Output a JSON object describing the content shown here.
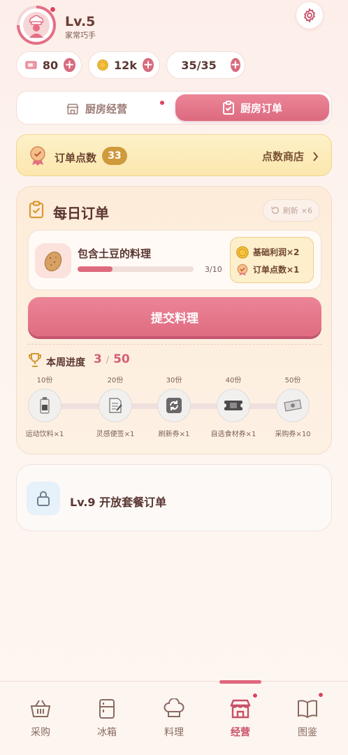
{
  "player": {
    "level": "Lv.5",
    "title": "家常巧手"
  },
  "currencies": [
    {
      "icon": "ticket-icon",
      "value": "80"
    },
    {
      "icon": "coin-icon",
      "value": "12k"
    },
    {
      "icon": "energy-icon",
      "value": "35/35"
    }
  ],
  "tabs": {
    "left": "厨房经营",
    "right": "厨房订单",
    "active": "right"
  },
  "points": {
    "label": "订单点数",
    "count": "33",
    "shop": "点数商店"
  },
  "daily": {
    "title": "每日订单",
    "refresh_label": "刷新",
    "refresh_count": "×6",
    "order": {
      "name": "包含土豆的料理",
      "progress_text": "3/10",
      "progress_fraction": 0.3
    },
    "rewards": [
      {
        "icon": "coin-icon",
        "label": "基础利润×2"
      },
      {
        "icon": "medal-icon",
        "label": "订单点数×1"
      }
    ],
    "submit": "提交料理",
    "week": {
      "label": "本周进度",
      "current": "3",
      "sep": "/",
      "total": "50"
    },
    "milestones": [
      {
        "top": "10份",
        "bottom": "运动饮料×1",
        "icon": "drink-can-icon"
      },
      {
        "top": "20份",
        "bottom": "灵感便签×1",
        "icon": "note-icon"
      },
      {
        "top": "30份",
        "bottom": "刷新券×1",
        "icon": "refresh-ticket-icon"
      },
      {
        "top": "40份",
        "bottom": "自选食材券×1",
        "icon": "ingredient-ticket-icon"
      },
      {
        "top": "50份",
        "bottom": "采购券×10",
        "icon": "purchase-ticket-icon"
      }
    ]
  },
  "locked": {
    "text": "Lv.9 开放套餐订单"
  },
  "nav": [
    {
      "label": "采购",
      "icon": "basket-icon"
    },
    {
      "label": "冰箱",
      "icon": "fridge-icon"
    },
    {
      "label": "料理",
      "icon": "chef-hat-icon"
    },
    {
      "label": "经营",
      "icon": "store-icon"
    },
    {
      "label": "图鉴",
      "icon": "book-icon"
    }
  ],
  "colors": {
    "accent": "#de6a7e",
    "gold": "#cf9a3c",
    "notification": "#e0435c"
  }
}
